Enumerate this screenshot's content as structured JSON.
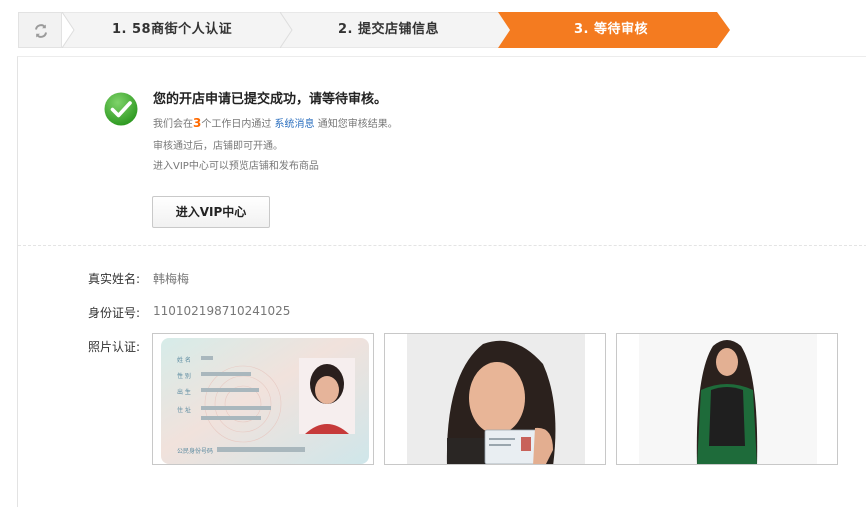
{
  "steps": [
    {
      "label": "1.  58商街个人认证",
      "state": "done"
    },
    {
      "label": "2.  提交店铺信息",
      "state": "done"
    },
    {
      "label": "3.  等待审核",
      "state": "active"
    }
  ],
  "colors": {
    "accent": "#f47b20",
    "link": "#2b6fbf",
    "success": "#3aa52c"
  },
  "success": {
    "title": "您的开店申请已提交成功，请等待审核。",
    "line1_prefix": "我们会在",
    "line1_number": "3",
    "line1_middle": "个工作日内通过",
    "line1_link": "系统消息",
    "line1_suffix": "通知您审核结果。",
    "line2": "审核通过后，店铺即可开通。",
    "line3": "进入VIP中心可以预览店铺和发布商品",
    "vip_button": "进入VIP中心"
  },
  "fields": {
    "name_label": "真实姓名:",
    "name_value": "韩梅梅",
    "id_label": "身份证号:",
    "id_value": "110102198710241025",
    "photo_label": "照片认证:"
  },
  "id_card_labels": {
    "name": "姓 名",
    "gender": "性 别",
    "birth": "出 生",
    "address": "住 址",
    "id_number": "公民身份号码"
  },
  "icons": [
    "refresh-icon",
    "check-circle-icon"
  ]
}
